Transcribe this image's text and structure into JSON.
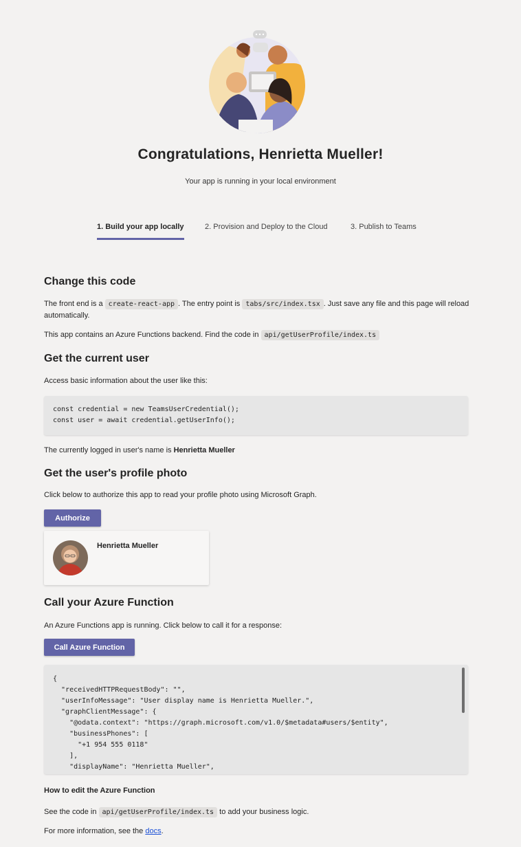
{
  "header": {
    "title": "Congratulations, Henrietta Mueller!",
    "subtitle": "Your app is running in your local environment",
    "illustration": "team-people-illustration"
  },
  "tabs": [
    {
      "label": "1. Build your app locally",
      "active": true
    },
    {
      "label": "2. Provision and Deploy to the Cloud",
      "active": false
    },
    {
      "label": "3. Publish to Teams",
      "active": false
    }
  ],
  "sections": {
    "change_code": {
      "heading": "Change this code",
      "p1_a": "The front end is a ",
      "p1_code1": "create-react-app",
      "p1_b": ". The entry point is ",
      "p1_code2": "tabs/src/index.tsx",
      "p1_c": ". Just save any file and this page will reload automatically.",
      "p2_a": "This app contains an Azure Functions backend. Find the code in ",
      "p2_code": "api/getUserProfile/index.ts"
    },
    "current_user": {
      "heading": "Get the current user",
      "intro": "Access basic information about the user like this:",
      "code": "const credential = new TeamsUserCredential();\nconst user = await credential.getUserInfo();",
      "logged_in_prefix": "The currently logged in user's name is ",
      "logged_in_name": "Henrietta Mueller"
    },
    "profile_photo": {
      "heading": "Get the user's profile photo",
      "intro": "Click below to authorize this app to read your profile photo using Microsoft Graph.",
      "button": "Authorize",
      "card_name": "Henrietta Mueller"
    },
    "azure_function": {
      "heading": "Call your Azure Function",
      "intro": "An Azure Functions app is running. Click below to call it for a response:",
      "button": "Call Azure Function",
      "response": "{\n  \"receivedHTTPRequestBody\": \"\",\n  \"userInfoMessage\": \"User display name is Henrietta Mueller.\",\n  \"graphClientMessage\": {\n    \"@odata.context\": \"https://graph.microsoft.com/v1.0/$metadata#users/$entity\",\n    \"businessPhones\": [\n      \"+1 954 555 0118\"\n    ],\n    \"displayName\": \"Henrietta Mueller\",",
      "edit_heading": "How to edit the Azure Function",
      "edit_a": "See the code in ",
      "edit_code": "api/getUserProfile/index.ts",
      "edit_b": " to add your business logic.",
      "more_a": "For more information, see the ",
      "more_link": "docs",
      "more_b": "."
    }
  },
  "colors": {
    "accent": "#6264a7",
    "background": "#f3f2f1",
    "code_bg": "#e6e6e6"
  }
}
